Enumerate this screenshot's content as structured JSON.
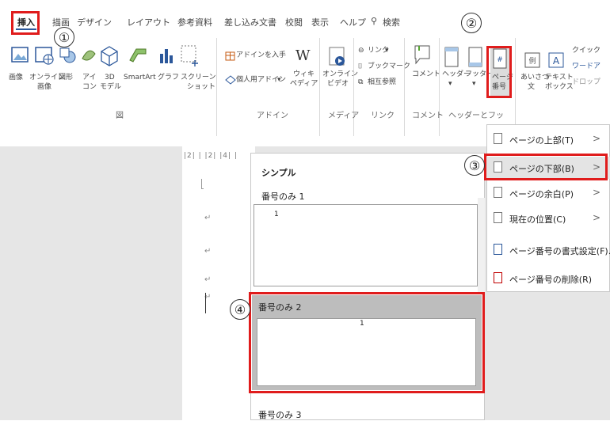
{
  "tabs": {
    "insert": "挿入",
    "draw": "描画",
    "design": "デザイン",
    "layout": "レイアウト",
    "references": "参考資料",
    "mailings": "差し込み文書",
    "review": "校閲",
    "view": "表示",
    "help": "ヘルプ",
    "search": "検索"
  },
  "ribbon": {
    "image": "画像",
    "online_image": [
      "オンライン",
      "画像"
    ],
    "shapes": "図形",
    "icons": [
      "アイ",
      "コン"
    ],
    "models_3d": [
      "3D",
      "モデル"
    ],
    "smartart": "SmartArt",
    "chart": "グラフ",
    "screenshot": [
      "スクリーン",
      "ショット"
    ],
    "get_addins": "アドインを入手",
    "personal_addins": "個人用アドイン",
    "wikipedia": [
      "ウィキ",
      "ペディア"
    ],
    "online_video": [
      "オンライン",
      "ビデオ"
    ],
    "link": "リンク",
    "bookmark": "ブックマーク",
    "crossref": "相互参照",
    "comment": "コメント",
    "header": "ヘッダー",
    "footer": "フッター",
    "page_number": [
      "ページ",
      "番号"
    ],
    "greeting": [
      "あいさつ",
      "文"
    ],
    "textbox": [
      "テキスト",
      "ボックス"
    ],
    "quick_parts": "クイック",
    "wordart": "ワードア",
    "dropcap": "ドロップ"
  },
  "groups": {
    "illustrations": "図",
    "addins": "アドイン",
    "media": "メディア",
    "links": "リンク",
    "comments": "コメント",
    "header_footer": "ヘッダーとフッ"
  },
  "ruler": "|2|  |  |2|  |4|  |",
  "menu": {
    "top": "ページの上部(T)",
    "bottom": "ページの下部(B)",
    "margin": "ページの余白(P)",
    "current": "現在の位置(C)",
    "format": "ページ番号の書式設定(F)...",
    "remove": "ページ番号の削除(R)"
  },
  "gallery": {
    "section": "シンプル",
    "item1": "番号のみ 1",
    "item2": "番号のみ 2",
    "item3": "番号のみ 3",
    "num": "1"
  },
  "doc": {
    "mark": "↵"
  },
  "markers": {
    "m1": "①",
    "m2": "②",
    "m3": "③",
    "m4": "④"
  },
  "colors": {
    "accent": "#2b579a",
    "highlight": "#e01c1c",
    "selected_band": "#bdbdbd"
  }
}
